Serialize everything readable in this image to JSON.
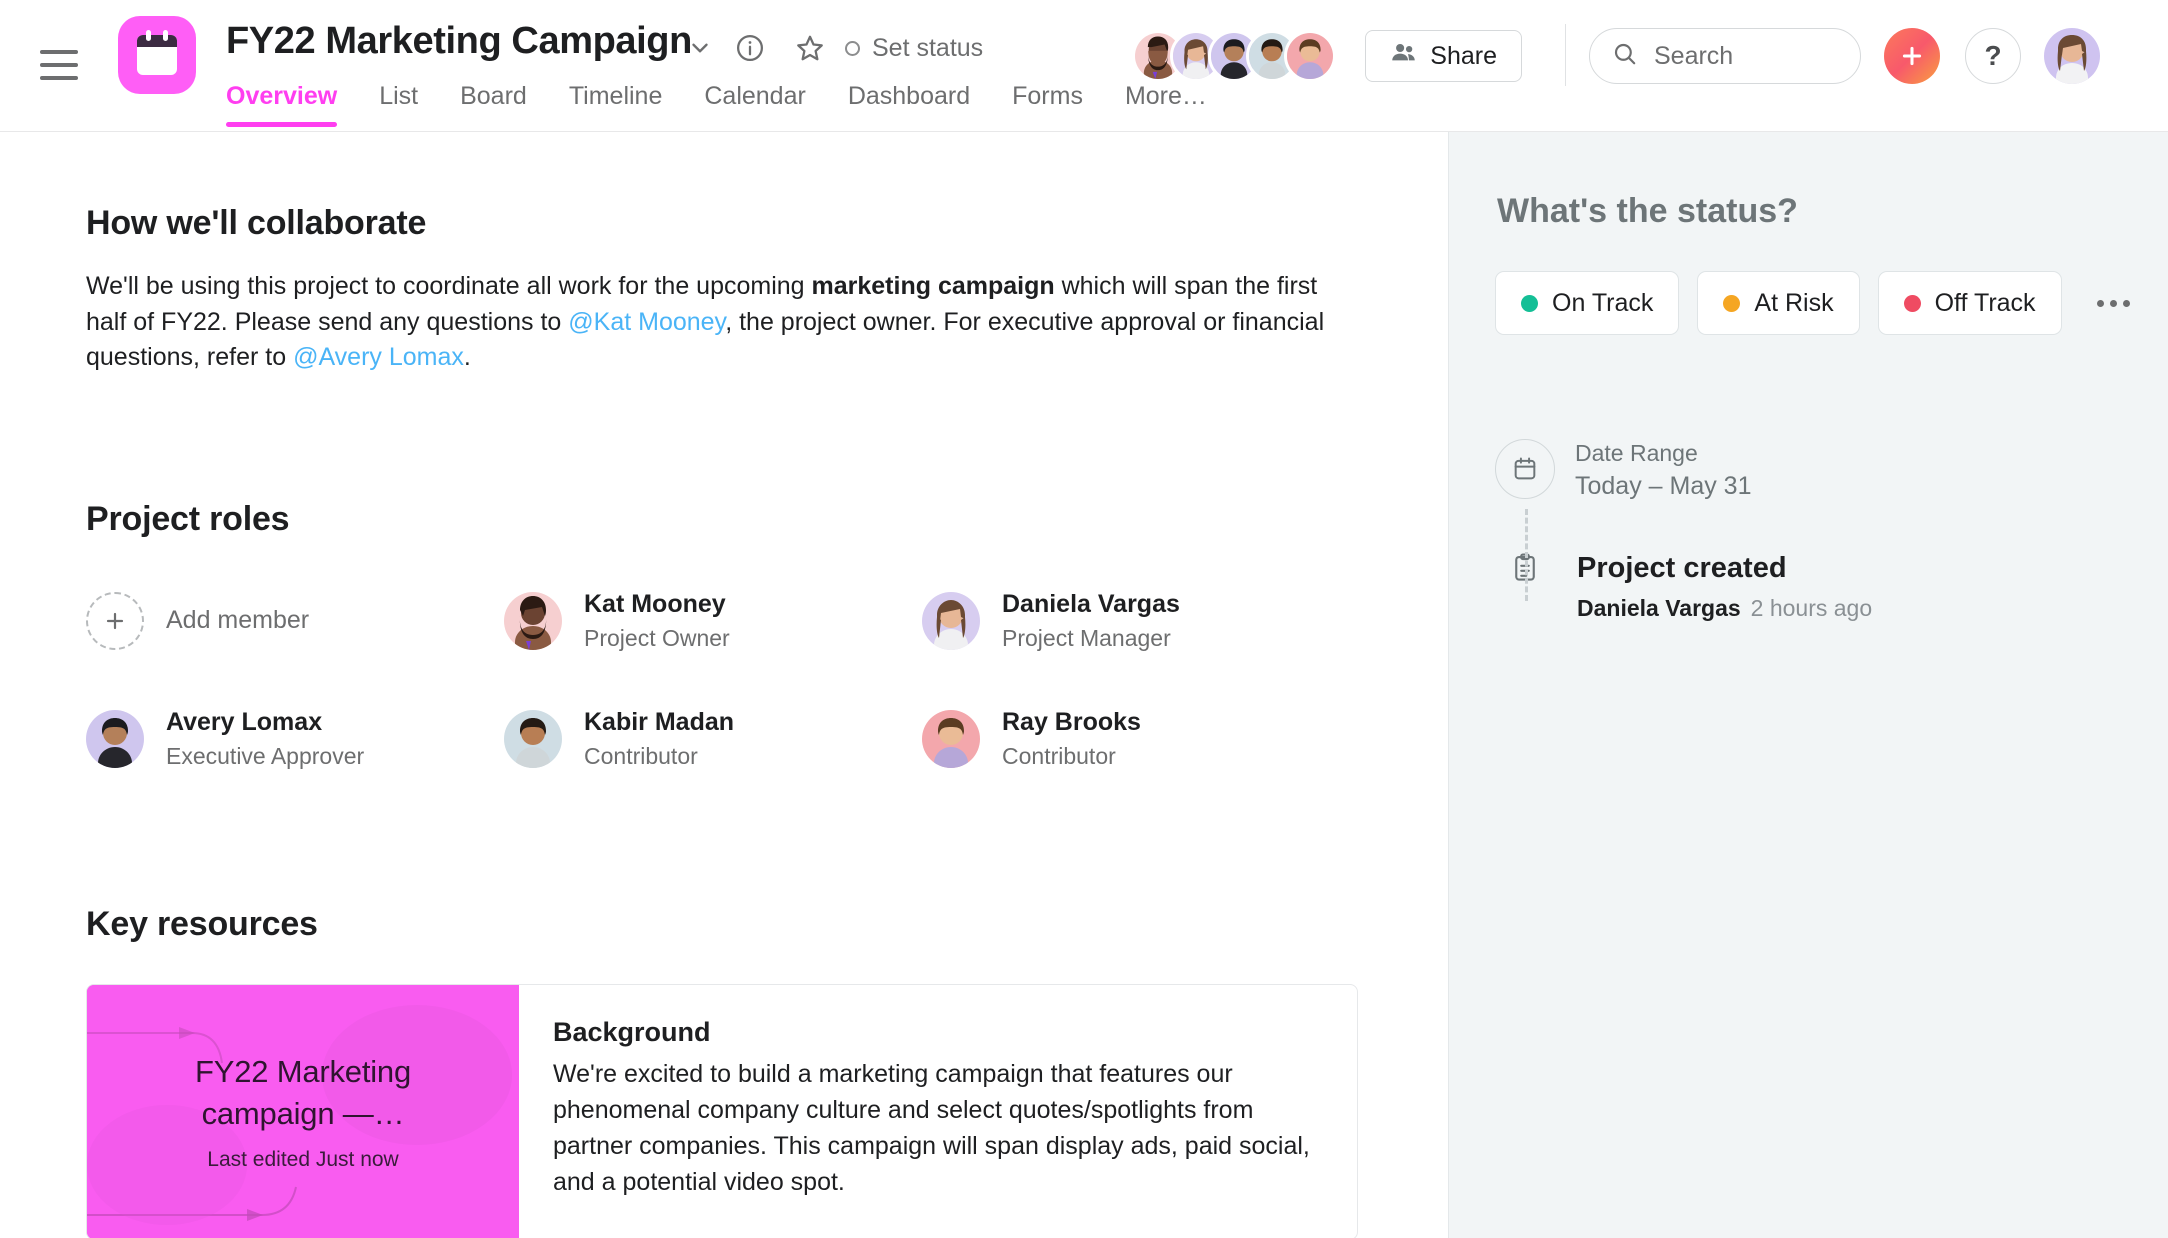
{
  "header": {
    "project_title": "FY22 Marketing Campaign",
    "set_status_label": "Set status",
    "share_label": "Share",
    "help_label": "?",
    "tabs": [
      {
        "label": "Overview",
        "active": true
      },
      {
        "label": "List",
        "active": false
      },
      {
        "label": "Board",
        "active": false
      },
      {
        "label": "Timeline",
        "active": false
      },
      {
        "label": "Calendar",
        "active": false
      },
      {
        "label": "Dashboard",
        "active": false
      },
      {
        "label": "Forms",
        "active": false
      },
      {
        "label": "More…",
        "active": false
      }
    ],
    "accent_color": "#ff3ef0"
  },
  "search": {
    "placeholder": "Search"
  },
  "collaborate": {
    "heading": "How we'll collaborate",
    "p1": "We'll be using this project to coordinate all work for the upcoming ",
    "bold1": "marketing campaign",
    "p2": " which will span the first half of FY22. Please send any questions to ",
    "mention1": "@Kat Mooney",
    "p3": ", the project owner. For executive approval or financial questions, refer to ",
    "mention2": "@Avery Lomax",
    "p4": "."
  },
  "roles": {
    "heading": "Project roles",
    "add_member_label": "Add member",
    "members": [
      {
        "name": "Kat Mooney",
        "role": "Project Owner",
        "ring": "#f6cfd0"
      },
      {
        "name": "Daniela Vargas",
        "role": "Project Manager",
        "ring": "#d7cdf0"
      },
      {
        "name": "Avery Lomax",
        "role": "Executive Approver",
        "ring": "#cfc6ee"
      },
      {
        "name": "Kabir Madan",
        "role": "Contributor",
        "ring": "#cfdde4"
      },
      {
        "name": "Ray Brooks",
        "role": "Contributor",
        "ring": "#f3a7ac"
      }
    ]
  },
  "key_resources": {
    "heading": "Key resources",
    "thumb_title": "FY22 Marketing campaign —…",
    "thumb_sub": "Last edited Just now",
    "card_title": "Background",
    "card_body": "We're excited to build a marketing campaign that features our phenomenal company culture and select quotes/spotlights from partner companies. This campaign will span display ads, paid social, and a potential video spot."
  },
  "sidebar": {
    "heading": "What's the status?",
    "status_options": [
      {
        "label": "On Track",
        "color": "#14bf96"
      },
      {
        "label": "At Risk",
        "color": "#f5a623"
      },
      {
        "label": "Off Track",
        "color": "#ef4b62"
      }
    ],
    "date_range_label": "Date Range",
    "date_range_value": "Today – May 31",
    "activity_title": "Project created",
    "activity_author": "Daniela Vargas",
    "activity_time": "2 hours ago"
  }
}
